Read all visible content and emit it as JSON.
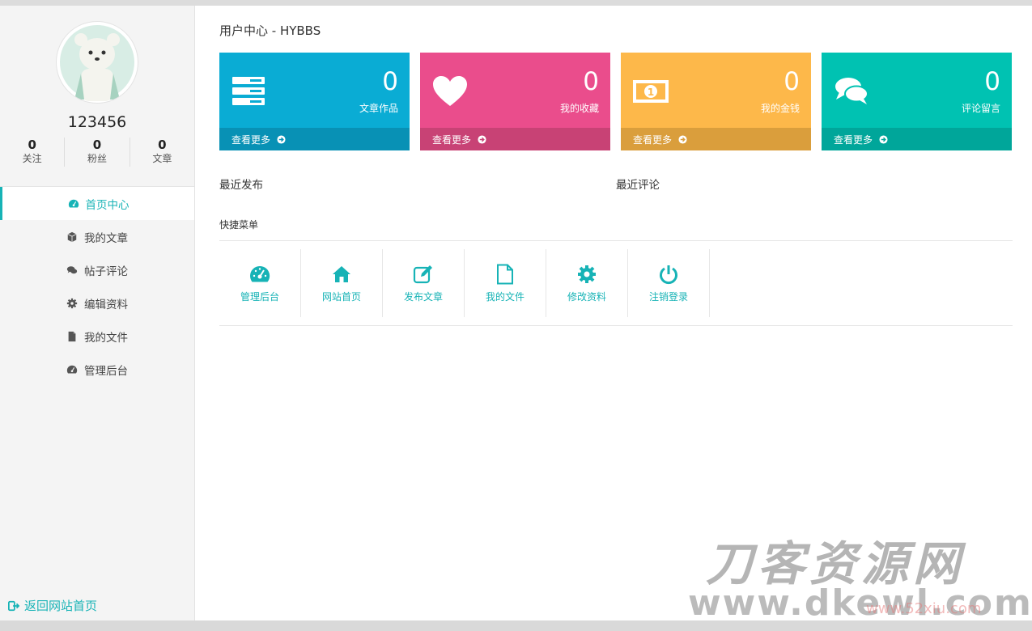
{
  "profile": {
    "username": "123456",
    "stats": [
      {
        "value": "0",
        "label": "关注"
      },
      {
        "value": "0",
        "label": "粉丝"
      },
      {
        "value": "0",
        "label": "文章"
      }
    ]
  },
  "sidebar": {
    "items": [
      {
        "label": "首页中心",
        "icon": "dashboard-icon"
      },
      {
        "label": "我的文章",
        "icon": "cube-icon"
      },
      {
        "label": "帖子评论",
        "icon": "comments-icon"
      },
      {
        "label": "编辑资料",
        "icon": "gear-icon"
      },
      {
        "label": "我的文件",
        "icon": "file-icon"
      },
      {
        "label": "管理后台",
        "icon": "dashboard-icon"
      }
    ],
    "back_label": "返回网站首页"
  },
  "main": {
    "title": "用户中心 - HYBBS",
    "cards": [
      {
        "count": "0",
        "label": "文章作品",
        "more": "查看更多",
        "icon": "server-icon",
        "color": "#0aacd4",
        "dark": "#0891b5"
      },
      {
        "count": "0",
        "label": "我的收藏",
        "more": "查看更多",
        "icon": "heart-icon",
        "color": "#ea4d8c",
        "dark": "#c84275"
      },
      {
        "count": "0",
        "label": "我的金钱",
        "more": "查看更多",
        "icon": "money-icon",
        "color": "#fdb84a",
        "dark": "#da9e3c"
      },
      {
        "count": "0",
        "label": "评论留言",
        "more": "查看更多",
        "icon": "comments-icon",
        "color": "#00c2b2",
        "dark": "#00a69a"
      }
    ],
    "recent_posts_label": "最近发布",
    "recent_comments_label": "最近评论",
    "quick_menu_title": "快捷菜单",
    "quick_menu": [
      {
        "label": "管理后台",
        "icon": "dashboard-icon"
      },
      {
        "label": "网站首页",
        "icon": "home-icon"
      },
      {
        "label": "发布文章",
        "icon": "edit-icon"
      },
      {
        "label": "我的文件",
        "icon": "file-icon"
      },
      {
        "label": "修改资料",
        "icon": "gear-icon"
      },
      {
        "label": "注销登录",
        "icon": "power-icon"
      }
    ]
  },
  "watermark": {
    "text": "刀客资源网",
    "url": "www.dkewl.com",
    "url2": "www.52xiu.com"
  },
  "colors": {
    "accent": "#17b3b6"
  }
}
